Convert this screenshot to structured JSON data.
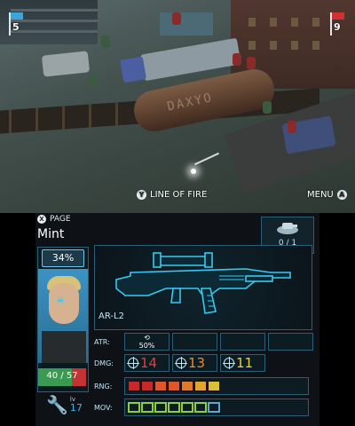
{
  "top_screen": {
    "blue_flag": {
      "count": "5",
      "color": "#3aa6d8"
    },
    "red_flag": {
      "count": "9",
      "color": "#d23030"
    },
    "tank_car_logo": "DAXYO",
    "line_of_fire": {
      "button": "Y",
      "label": "LINE OF FIRE"
    },
    "menu": {
      "label": "MENU",
      "button": "A"
    }
  },
  "bottom_screen": {
    "page": {
      "button": "X",
      "label": "PAGE"
    },
    "unit_name": "Mint",
    "hit_chance": "34%",
    "hp": {
      "text": "40 / 57",
      "current": 40,
      "max": 57,
      "color_current": "#3b9a52",
      "color_missing": "#c33333"
    },
    "level": {
      "icon": "wrench-icon",
      "label": "lv",
      "value": "17"
    },
    "weapon": {
      "name": "AR-L2",
      "icon": "assault-rifle-icon"
    },
    "ammo": {
      "icon": "grenade-icon",
      "text": "0 / 1"
    },
    "stats": {
      "atr": {
        "label": "ATR:",
        "icon": "refresh-arrow-icon",
        "value": "50%"
      },
      "dmg": {
        "label": "DMG:",
        "values": [
          {
            "value": "14",
            "color": "#e04040"
          },
          {
            "value": "13",
            "color": "#f08a2a"
          },
          {
            "value": "11",
            "color": "#e8d23a"
          }
        ]
      },
      "rng": {
        "label": "RNG:",
        "cells": [
          "#c82828",
          "#c82828",
          "#e0562a",
          "#e0562a",
          "#e07a28",
          "#e0a52a",
          "#d8c232"
        ]
      },
      "mov": {
        "label": "MOV:",
        "cells": [
          "#8fcf3a",
          "#8fcf3a",
          "#8fcf3a",
          "#8fcf3a",
          "#8fcf3a",
          "#8fcf3a",
          "#5fa6d2"
        ]
      }
    }
  }
}
